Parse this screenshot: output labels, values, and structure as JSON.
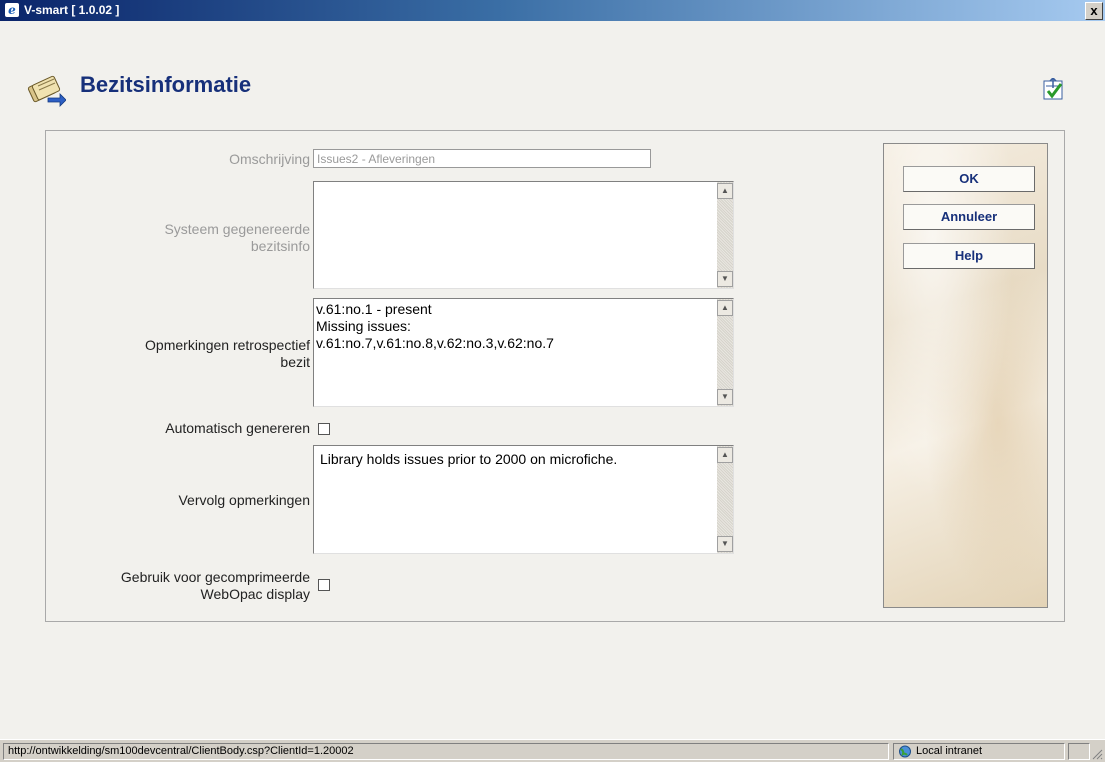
{
  "window": {
    "title": "V-smart [ 1.0.02 ]",
    "close_label": "x"
  },
  "header": {
    "title": "Bezitsinformatie",
    "icon": "holdings-icon",
    "corner_icon": "navigate-check-icon"
  },
  "form": {
    "omschrijving": {
      "label": "Omschrijving",
      "value": "Issues2 - Afleveringen"
    },
    "systeem": {
      "label_line1": "Systeem gegenereerde",
      "label_line2": "bezitsinfo",
      "value": ""
    },
    "opmerkingen_retro": {
      "label_line1": "Opmerkingen retrospectief",
      "label_line2": "bezit",
      "value": "v.61:no.1 - present\nMissing issues:\nv.61:no.7,v.61:no.8,v.62:no.3,v.62:no.7"
    },
    "automatisch": {
      "label": "Automatisch genereren",
      "checked": false
    },
    "vervolg": {
      "label": "Vervolg opmerkingen",
      "value": "Library holds issues prior to 2000 on microfiche."
    },
    "gebruik": {
      "label_line1": "Gebruik voor gecomprimeerde",
      "label_line2": "WebOpac display",
      "checked": false
    }
  },
  "buttons": {
    "ok": "OK",
    "annuleer": "Annuleer",
    "help": "Help"
  },
  "statusbar": {
    "url": "http://ontwikkelding/sm100devcentral/ClientBody.csp?ClientId=1.20002",
    "zone": "Local intranet"
  }
}
